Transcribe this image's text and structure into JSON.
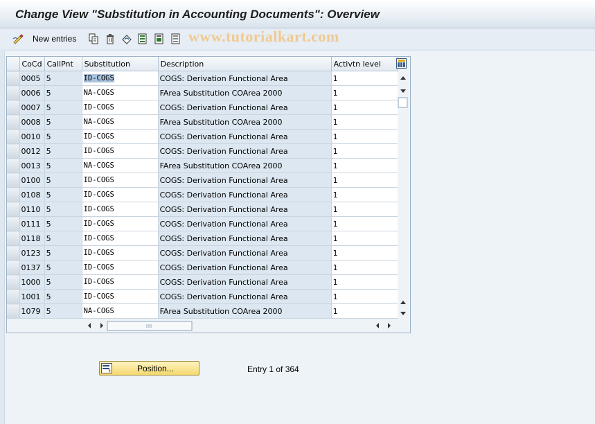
{
  "window": {
    "title": "Change View \"Substitution in Accounting Documents\": Overview"
  },
  "toolbar": {
    "new_entries_label": "New entries",
    "icons": [
      "change-display-icon",
      "copy-icon",
      "delete-icon",
      "undo-icon",
      "select-all-icon",
      "select-block-icon",
      "deselect-all-icon"
    ]
  },
  "watermark": "www.tutorialkart.com",
  "table": {
    "columns": {
      "cocd": "CoCd",
      "callpnt": "CallPnt",
      "substitution": "Substitution",
      "description": "Description",
      "activation": "Activtn level"
    },
    "rows": [
      {
        "cocd": "0005",
        "callpnt": "5",
        "substitution": "ID-COGS",
        "description": "COGS: Derivation Functional Area",
        "activation": "1"
      },
      {
        "cocd": "0006",
        "callpnt": "5",
        "substitution": "NA-COGS",
        "description": "FArea Substitution COArea 2000",
        "activation": "1"
      },
      {
        "cocd": "0007",
        "callpnt": "5",
        "substitution": "ID-COGS",
        "description": "COGS: Derivation Functional Area",
        "activation": "1"
      },
      {
        "cocd": "0008",
        "callpnt": "5",
        "substitution": "NA-COGS",
        "description": "FArea Substitution COArea 2000",
        "activation": "1"
      },
      {
        "cocd": "0010",
        "callpnt": "5",
        "substitution": "ID-COGS",
        "description": "COGS: Derivation Functional Area",
        "activation": "1"
      },
      {
        "cocd": "0012",
        "callpnt": "5",
        "substitution": "ID-COGS",
        "description": "COGS: Derivation Functional Area",
        "activation": "1"
      },
      {
        "cocd": "0013",
        "callpnt": "5",
        "substitution": "NA-COGS",
        "description": "FArea Substitution COArea 2000",
        "activation": "1"
      },
      {
        "cocd": "0100",
        "callpnt": "5",
        "substitution": "ID-COGS",
        "description": "COGS: Derivation Functional Area",
        "activation": "1"
      },
      {
        "cocd": "0108",
        "callpnt": "5",
        "substitution": "ID-COGS",
        "description": "COGS: Derivation Functional Area",
        "activation": "1"
      },
      {
        "cocd": "0110",
        "callpnt": "5",
        "substitution": "ID-COGS",
        "description": "COGS: Derivation Functional Area",
        "activation": "1"
      },
      {
        "cocd": "0111",
        "callpnt": "5",
        "substitution": "ID-COGS",
        "description": "COGS: Derivation Functional Area",
        "activation": "1"
      },
      {
        "cocd": "0118",
        "callpnt": "5",
        "substitution": "ID-COGS",
        "description": "COGS: Derivation Functional Area",
        "activation": "1"
      },
      {
        "cocd": "0123",
        "callpnt": "5",
        "substitution": "ID-COGS",
        "description": "COGS: Derivation Functional Area",
        "activation": "1"
      },
      {
        "cocd": "0137",
        "callpnt": "5",
        "substitution": "ID-COGS",
        "description": "COGS: Derivation Functional Area",
        "activation": "1"
      },
      {
        "cocd": "1000",
        "callpnt": "5",
        "substitution": "ID-COGS",
        "description": "COGS: Derivation Functional Area",
        "activation": "1"
      },
      {
        "cocd": "1001",
        "callpnt": "5",
        "substitution": "ID-COGS",
        "description": "COGS: Derivation Functional Area",
        "activation": "1"
      },
      {
        "cocd": "1079",
        "callpnt": "5",
        "substitution": "NA-COGS",
        "description": "FArea Substitution COArea 2000",
        "activation": "1"
      }
    ],
    "selected_row": 0
  },
  "footer": {
    "position_button_label": "Position...",
    "entry_info": "Entry 1 of 364"
  },
  "colors": {
    "key_cell": "#dce7f1",
    "edit_cell": "#ffffff",
    "selection": "#a9c3de",
    "position_button": "#f3d86e",
    "watermark": "#f1c98f"
  }
}
